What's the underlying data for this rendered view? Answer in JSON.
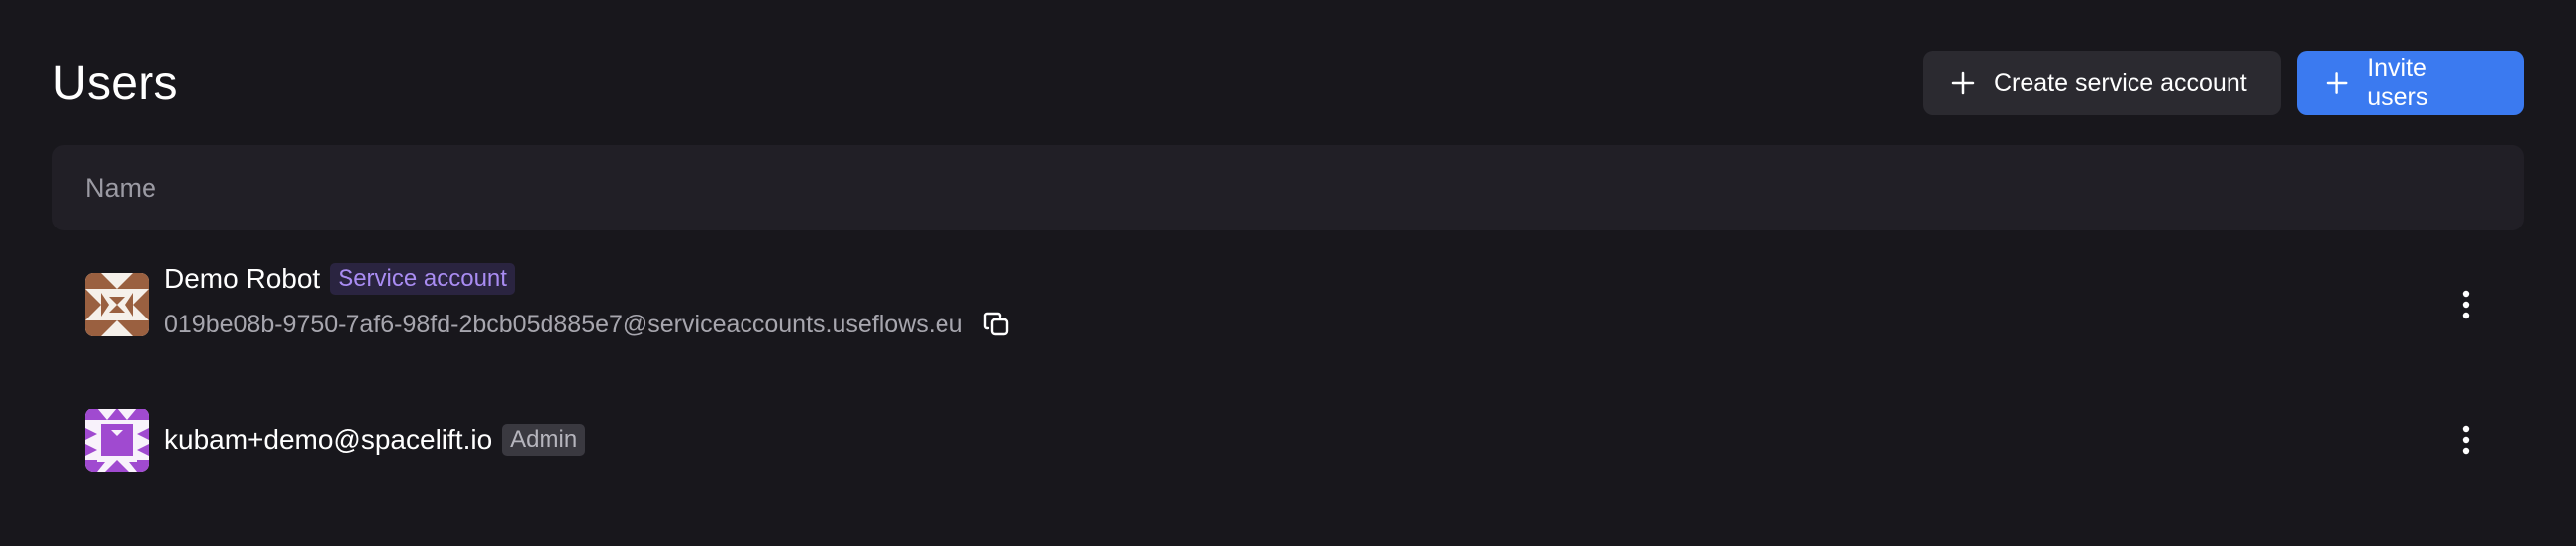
{
  "header": {
    "title": "Users",
    "create_service_account_label": "Create service account",
    "invite_users_label": "Invite users"
  },
  "table": {
    "columns": [
      "Name"
    ],
    "rows": [
      {
        "name": "Demo Robot",
        "badge": "Service account",
        "email": "019be08b-9750-7af6-98fd-2bcb05d885e7@serviceaccounts.useflows.eu",
        "avatar_icon": "identicon-brown",
        "actions_icon": "kebab-menu-icon"
      },
      {
        "name": "kubam+demo@spacelift.io",
        "badge": "Admin",
        "avatar_icon": "identicon-purple",
        "actions_icon": "kebab-menu-icon"
      }
    ]
  },
  "colors": {
    "background": "#18171c",
    "primary": "#3b7af0",
    "service_badge": "#a98cf2",
    "admin_badge_bg": "#3a3940"
  }
}
